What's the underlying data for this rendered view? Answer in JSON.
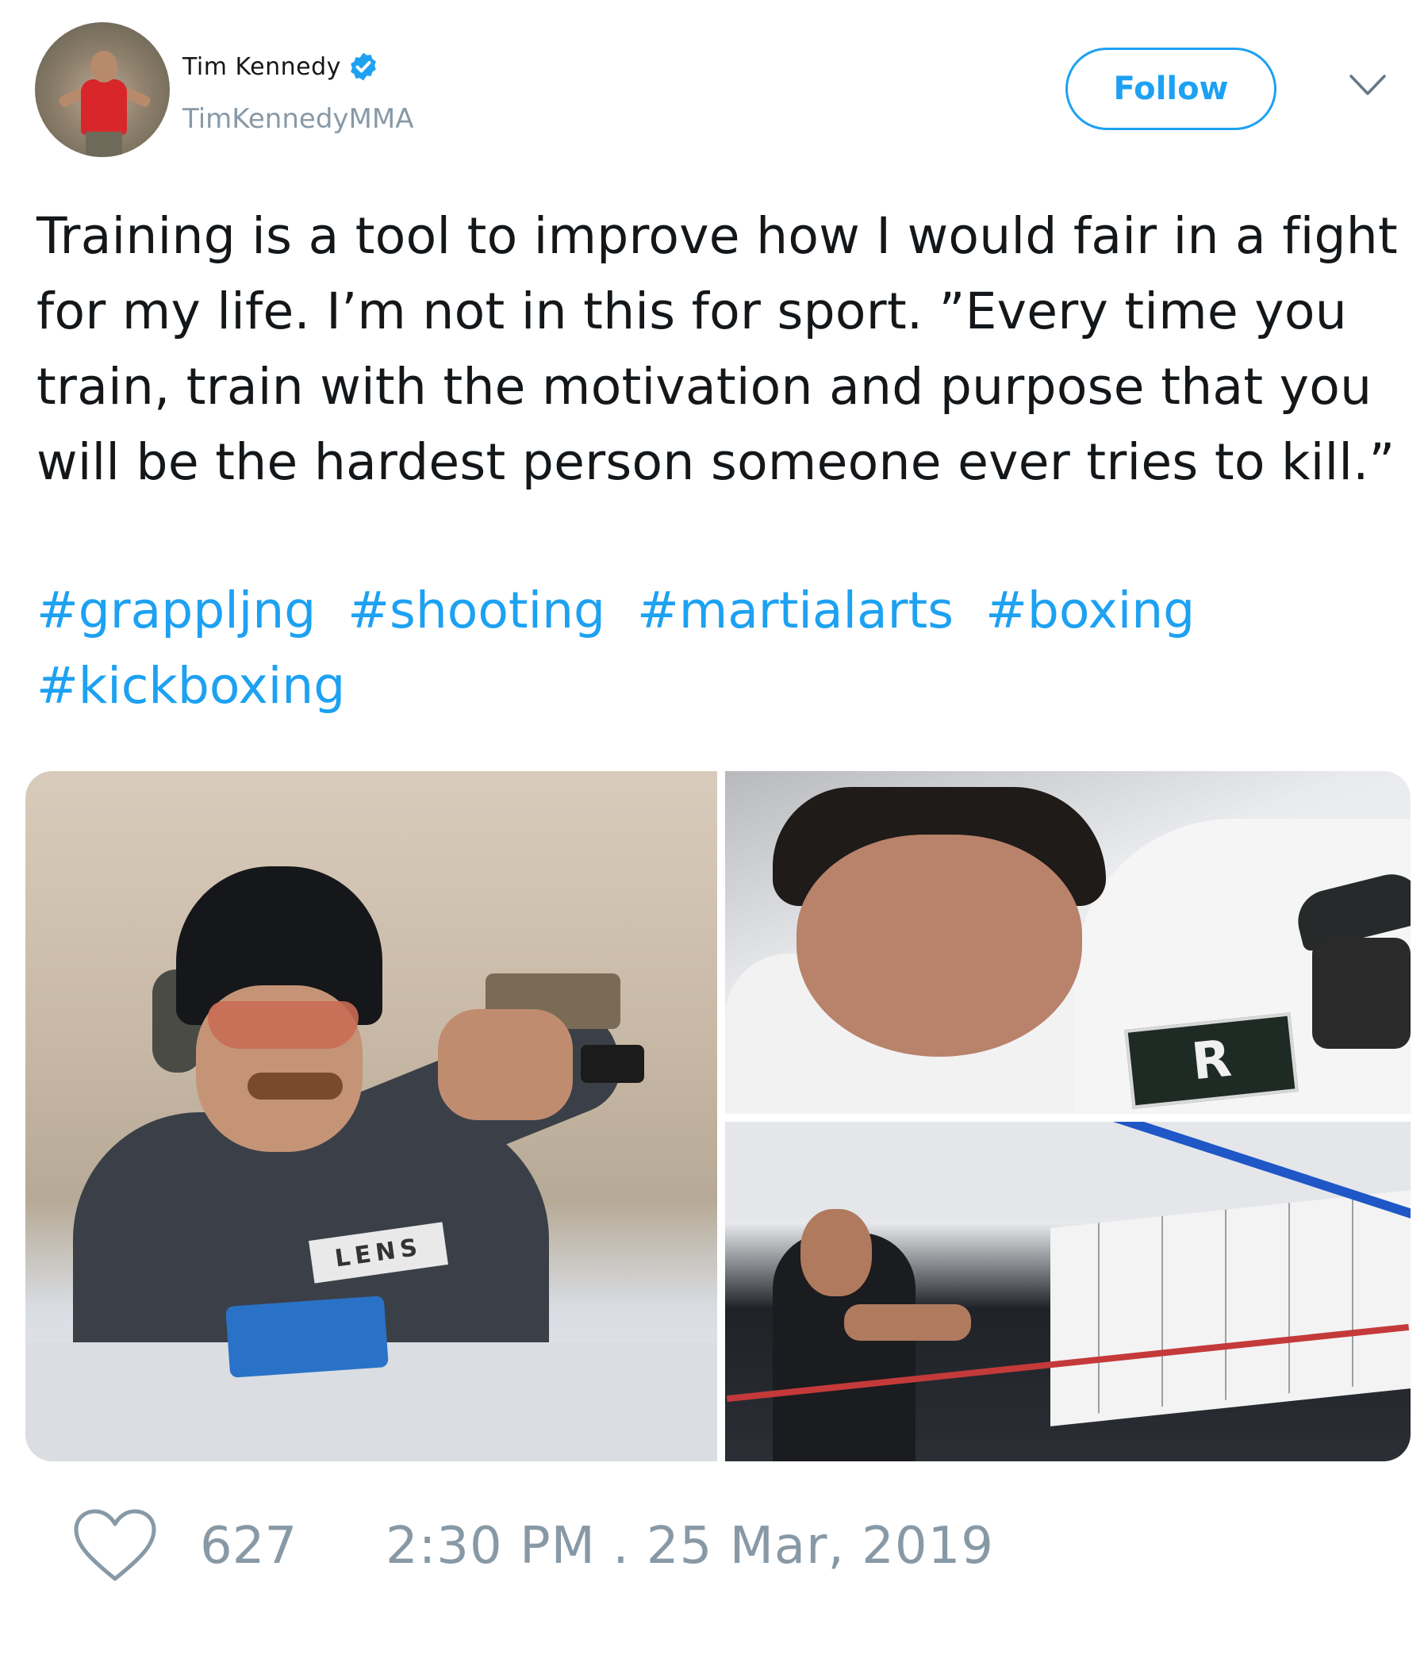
{
  "author": {
    "display_name": "Tim Kennedy",
    "handle": "TimKennedyMMA",
    "verified": true,
    "avatar_icon": "profile-photo"
  },
  "actions": {
    "follow_label": "Follow",
    "menu_icon": "chevron-down-icon"
  },
  "tweet": {
    "text": "Training is a tool to improve how I would fair in a fight for my life. I’m not in this for sport. ”Every time you train, train with the motivation and purpose that you will be the hardest person someone ever tries to kill.”",
    "hashtags": [
      "#grappljng",
      "#shooting",
      "#martialarts",
      "#boxing",
      "#kickboxing"
    ]
  },
  "media": {
    "count": 3,
    "left_logo_text": "LENS",
    "top_right_patch_text": "R"
  },
  "footer": {
    "like_icon": "heart-icon",
    "like_count": "627",
    "timestamp": "2:30 PM . 25 Mar, 2019"
  },
  "colors": {
    "accent": "#1da1f2",
    "muted": "#8899a6",
    "text": "#14171a"
  }
}
